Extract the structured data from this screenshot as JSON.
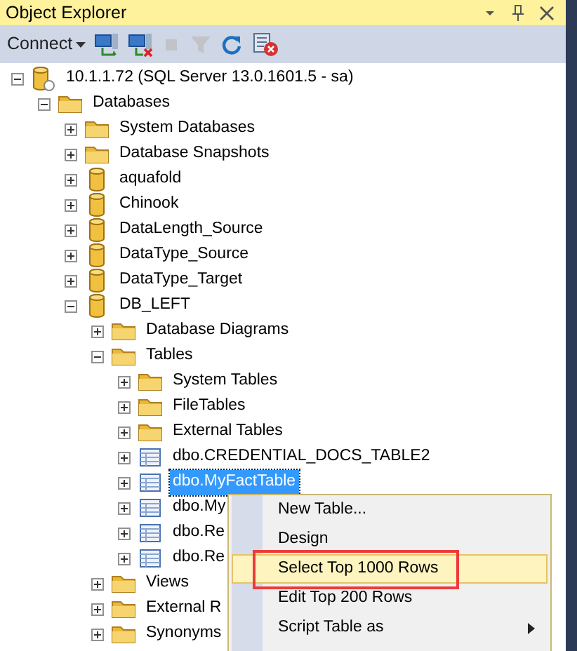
{
  "window": {
    "title": "Object Explorer"
  },
  "toolbar": {
    "connect_label": "Connect",
    "buttons": [
      {
        "kind": "connect",
        "disabled": false
      },
      {
        "kind": "disconnect",
        "disabled": false
      },
      {
        "kind": "stop",
        "disabled": true
      },
      {
        "kind": "filter",
        "disabled": true
      },
      {
        "kind": "refresh",
        "disabled": false
      },
      {
        "kind": "activity",
        "disabled": false
      }
    ]
  },
  "tree": [
    {
      "kind": "server",
      "label": "10.1.1.72 (SQL Server 13.0.1601.5 - sa)",
      "expanded": true,
      "selected": false,
      "children": [
        {
          "kind": "folder",
          "label": "Databases",
          "expanded": true,
          "selected": false,
          "children": [
            {
              "kind": "folder",
              "label": "System Databases",
              "expanded": false,
              "selected": false
            },
            {
              "kind": "folder",
              "label": "Database Snapshots",
              "expanded": false,
              "selected": false
            },
            {
              "kind": "database",
              "label": "aquafold",
              "expanded": false,
              "selected": false
            },
            {
              "kind": "database",
              "label": "Chinook",
              "expanded": false,
              "selected": false
            },
            {
              "kind": "database",
              "label": "DataLength_Source",
              "expanded": false,
              "selected": false
            },
            {
              "kind": "database",
              "label": "DataType_Source",
              "expanded": false,
              "selected": false
            },
            {
              "kind": "database",
              "label": "DataType_Target",
              "expanded": false,
              "selected": false
            },
            {
              "kind": "database",
              "label": "DB_LEFT",
              "expanded": true,
              "selected": false,
              "children": [
                {
                  "kind": "folder",
                  "label": "Database Diagrams",
                  "expanded": false,
                  "selected": false
                },
                {
                  "kind": "folder",
                  "label": "Tables",
                  "expanded": true,
                  "selected": false,
                  "children": [
                    {
                      "kind": "folder",
                      "label": "System Tables",
                      "expanded": false,
                      "selected": false
                    },
                    {
                      "kind": "folder",
                      "label": "FileTables",
                      "expanded": false,
                      "selected": false
                    },
                    {
                      "kind": "folder",
                      "label": "External Tables",
                      "expanded": false,
                      "selected": false
                    },
                    {
                      "kind": "table",
                      "label": "dbo.CREDENTIAL_DOCS_TABLE2",
                      "expanded": false,
                      "selected": false
                    },
                    {
                      "kind": "table",
                      "label": "dbo.MyFactTable",
                      "expanded": false,
                      "selected": true
                    },
                    {
                      "kind": "table",
                      "label": "dbo.My",
                      "expanded": false,
                      "selected": false
                    },
                    {
                      "kind": "table",
                      "label": "dbo.Re",
                      "expanded": false,
                      "selected": false
                    },
                    {
                      "kind": "table",
                      "label": "dbo.Re",
                      "expanded": false,
                      "selected": false
                    }
                  ]
                },
                {
                  "kind": "folder",
                  "label": "Views",
                  "expanded": false,
                  "selected": false
                },
                {
                  "kind": "folder",
                  "label": "External R",
                  "expanded": false,
                  "selected": false
                },
                {
                  "kind": "folder",
                  "label": "Synonyms",
                  "expanded": false,
                  "selected": false
                }
              ]
            }
          ]
        }
      ]
    }
  ],
  "context_menu": {
    "items": [
      {
        "label": "New Table...",
        "selected": false,
        "submenu": false
      },
      {
        "label": "Design",
        "selected": false,
        "submenu": false
      },
      {
        "label": "Select Top 1000 Rows",
        "selected": true,
        "submenu": false
      },
      {
        "label": "Edit Top 200 Rows",
        "selected": false,
        "submenu": false
      },
      {
        "label": "Script Table as",
        "selected": false,
        "submenu": true
      }
    ]
  }
}
